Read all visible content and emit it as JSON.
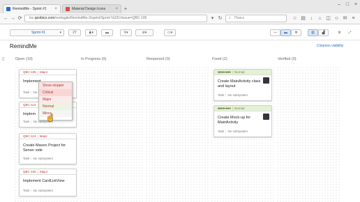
{
  "browser": {
    "tabs": [
      {
        "title": "RemindMe - Sprint #1",
        "active": true
      },
      {
        "title": "Material Design Icons",
        "active": false
      }
    ],
    "url_prefix": "loc.",
    "url_host": "qoobico.com",
    "url_path": "/rest/agile/RemindMe-3/sprint/Sprint %231#issue=QBC-105",
    "search_placeholder": "Поиск"
  },
  "header": {
    "sprint_label": "Sprint #1",
    "date_label": "27"
  },
  "board": {
    "title": "RemindMe",
    "column_visibility": "Columns visibility",
    "columns": [
      {
        "label": "Open (10)"
      },
      {
        "label": "In Progress (0)"
      },
      {
        "label": "Reopened (0)"
      },
      {
        "label": "Fixed (2)"
      },
      {
        "label": "Verified (0)"
      }
    ]
  },
  "cards": {
    "open": [
      {
        "id": "QBC-105",
        "priority": "Major",
        "title": "Implement",
        "type": "Task",
        "subsystem": "No subsystem"
      },
      {
        "id": "QBC-114",
        "priority": "",
        "title": "Implem",
        "type": "Task",
        "subsystem": "No subsystem"
      },
      {
        "id": "QBC-113",
        "priority": "Major",
        "title": "Create Maven Project for Server side",
        "type": "Task",
        "subsystem": "No subsystem"
      },
      {
        "id": "QBC-100",
        "priority": "Major",
        "title": "Implement CardListView",
        "type": "Task",
        "subsystem": "No subsystem"
      }
    ],
    "fixed": [
      {
        "id": "QBC-103",
        "priority": "Normal",
        "title": "Create MainActivity class and layout",
        "type": "Task",
        "subsystem": "No subsystem"
      },
      {
        "id": "QBC-104",
        "priority": "Normal",
        "title": "Create Mock-up for MainActivity",
        "type": "Task",
        "subsystem": "No subsystem"
      }
    ]
  },
  "priority_dropdown": {
    "options": [
      {
        "label": "Show-stopper",
        "color": "#fbe3e3"
      },
      {
        "label": "Critical",
        "color": "#f9d6d6"
      },
      {
        "label": "Major",
        "color": "#fbeaea"
      },
      {
        "label": "Normal",
        "color": "#ebf3e2"
      },
      {
        "label": "Minor",
        "color": "#f5f5f5"
      }
    ]
  }
}
